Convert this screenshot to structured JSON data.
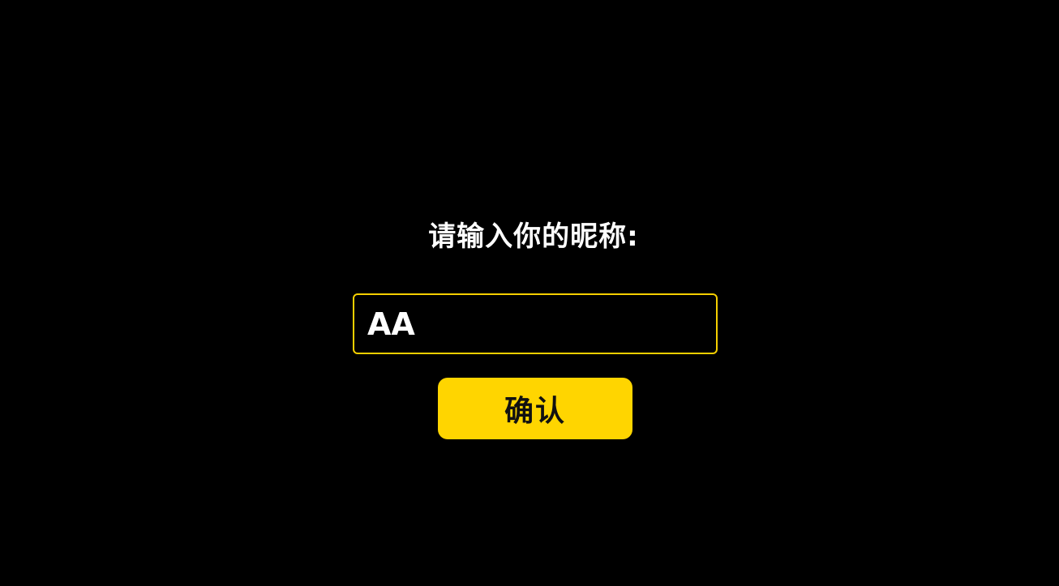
{
  "dialog": {
    "prompt": "请输入你的昵称:",
    "nickname_input": {
      "value": "AA",
      "placeholder": ""
    },
    "confirm_label": "确认"
  },
  "colors": {
    "background": "#000000",
    "accent": "#ffd500",
    "input_border": "#f5cf00",
    "text": "#ffffff"
  }
}
